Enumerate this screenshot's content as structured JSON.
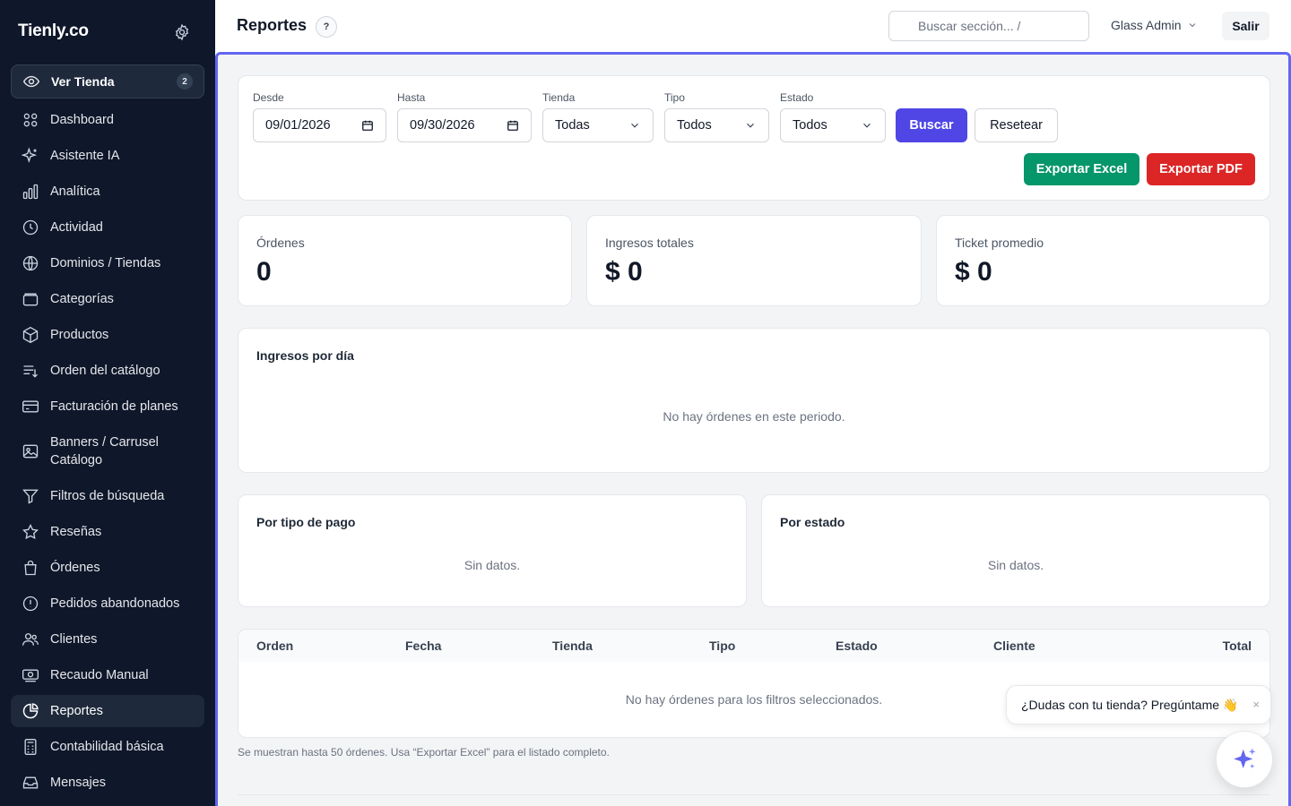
{
  "sidebar": {
    "brand": "Tienly.co",
    "view_store": {
      "label": "Ver Tienda",
      "badge": "2"
    },
    "items": [
      {
        "label": "Dashboard",
        "icon": "dashboard-icon"
      },
      {
        "label": "Asistente IA",
        "icon": "sparkles-icon"
      },
      {
        "label": "Analítica",
        "icon": "bar-chart-icon"
      },
      {
        "label": "Actividad",
        "icon": "clock-icon"
      },
      {
        "label": "Dominios / Tiendas",
        "icon": "globe-icon"
      },
      {
        "label": "Categorías",
        "icon": "folder-icon"
      },
      {
        "label": "Productos",
        "icon": "box-icon"
      },
      {
        "label": "Orden del catálogo",
        "icon": "sort-list-icon"
      },
      {
        "label": "Facturación de planes",
        "icon": "credit-card-icon"
      },
      {
        "label": "Banners / Carrusel Catálogo",
        "icon": "image-icon"
      },
      {
        "label": "Filtros de búsqueda",
        "icon": "filter-icon"
      },
      {
        "label": "Reseñas",
        "icon": "star-icon"
      },
      {
        "label": "Órdenes",
        "icon": "shopping-bag-icon"
      },
      {
        "label": "Pedidos abandonados",
        "icon": "alert-circle-icon"
      },
      {
        "label": "Clientes",
        "icon": "users-icon"
      },
      {
        "label": "Recaudo Manual",
        "icon": "cash-icon"
      },
      {
        "label": "Reportes",
        "icon": "pie-chart-icon",
        "active": true
      },
      {
        "label": "Contabilidad básica",
        "icon": "calculator-icon"
      },
      {
        "label": "Mensajes",
        "icon": "inbox-icon"
      }
    ]
  },
  "header": {
    "title": "Reportes",
    "help": "?",
    "search_placeholder": "Buscar sección...  /",
    "user": "Glass Admin",
    "logout": "Salir"
  },
  "filters": {
    "from_label": "Desde",
    "from_value": "09/01/2026",
    "to_label": "Hasta",
    "to_value": "09/30/2026",
    "store_label": "Tienda",
    "store_value": "Todas",
    "type_label": "Tipo",
    "type_value": "Todos",
    "status_label": "Estado",
    "status_value": "Todos",
    "search_button": "Buscar",
    "reset_button": "Resetear",
    "export_excel": "Exportar Excel",
    "export_pdf": "Exportar PDF"
  },
  "kpis": [
    {
      "label": "Órdenes",
      "value": "0"
    },
    {
      "label": "Ingresos totales",
      "value": "$ 0"
    },
    {
      "label": "Ticket promedio",
      "value": "$ 0"
    }
  ],
  "daily": {
    "title": "Ingresos por día",
    "empty": "No hay órdenes en este periodo."
  },
  "by_payment": {
    "title": "Por tipo de pago",
    "empty": "Sin datos."
  },
  "by_status": {
    "title": "Por estado",
    "empty": "Sin datos."
  },
  "table": {
    "columns": [
      "Orden",
      "Fecha",
      "Tienda",
      "Tipo",
      "Estado",
      "Cliente",
      "Total"
    ],
    "empty": "No hay órdenes para los filtros seleccionados."
  },
  "footnote": "Se muestran hasta 50 órdenes. Usa “Exportar Excel” para el listado completo.",
  "chat": {
    "prompt": "¿Dudas con tu tienda? Pregúntame 👋",
    "close": "×"
  },
  "colors": {
    "sidebar_bg": "#0f172a",
    "accent": "#4f46e5",
    "excel": "#059669",
    "pdf": "#dc2626",
    "focus_ring": "#6366f1"
  }
}
